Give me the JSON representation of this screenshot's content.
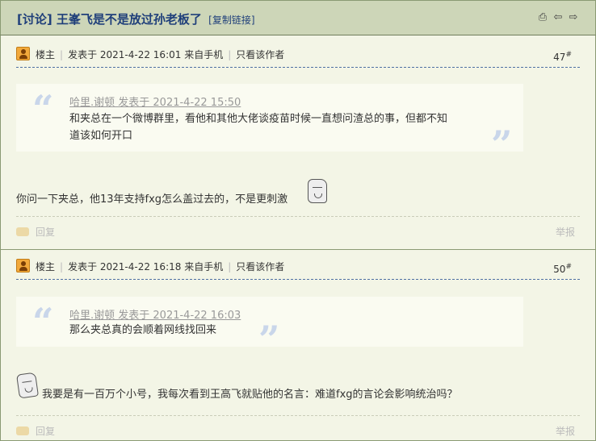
{
  "header": {
    "title": "[讨论] 王峯飞是不是放过孙老板了",
    "copy_link": "[复制链接]",
    "icons": [
      "print-icon",
      "previous-arrow-icon",
      "next-arrow-icon"
    ]
  },
  "posts": [
    {
      "author_label": "楼主",
      "posted": "发表于 2021-4-22 16:01",
      "source": "来自手机",
      "only_author": "只看该作者",
      "floor": "47",
      "floor_sup": "#",
      "quote": {
        "author_time": "哈里.谢顿 发表于 2021-4-22 15:50",
        "body": "和夹总在一个微博群里，看他和其他大佬谈疫苗时候一直想问渣总的事，但都不知道该如何开口"
      },
      "content": "你问一下夹总，他13年支持fxg怎么盖过去的，不是更刺激",
      "reply": "回复",
      "report": "举报"
    },
    {
      "author_label": "楼主",
      "posted": "发表于 2021-4-22 16:18",
      "source": "来自手机",
      "only_author": "只看该作者",
      "floor": "50",
      "floor_sup": "#",
      "quote": {
        "author_time": "哈里.谢顿 发表于 2021-4-22 16:03",
        "body": "那么夹总真的会顺着网线找回来"
      },
      "content": "我要是有一百万个小号，我每次看到王高飞就贴他的名言：难道fxg的言论会影响统治吗？",
      "reply": "回复",
      "report": "举报"
    }
  ]
}
